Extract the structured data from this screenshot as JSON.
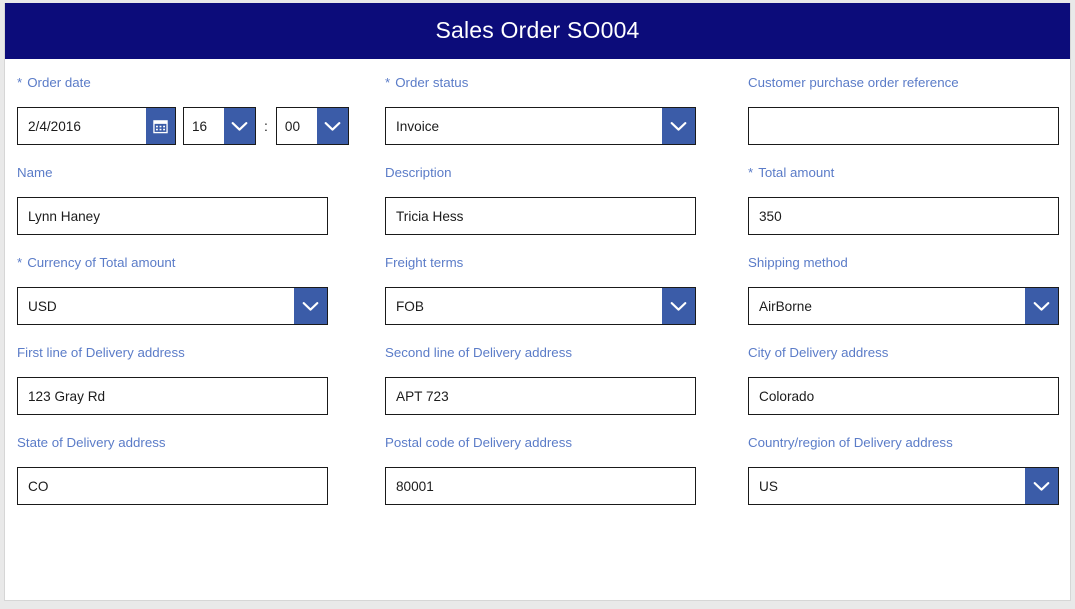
{
  "header": {
    "title": "Sales Order SO004",
    "background": "#0c0c7a",
    "text_color": "#ffffff"
  },
  "theme": {
    "label_color": "#5b7cc8",
    "accent_button": "#3b5ca8",
    "field_border": "#1a1a1a",
    "page_background": "#e9e9e9",
    "card_background": "#ffffff"
  },
  "required_marker": "*",
  "time_separator": ":",
  "fields": {
    "order_date": {
      "label": "Order date",
      "required": true,
      "value": "2/4/2016",
      "calendar_icon": "calendar-icon",
      "hour": "16",
      "minute": "00"
    },
    "order_status": {
      "label": "Order status",
      "required": true,
      "value": "Invoice"
    },
    "customer_po_reference": {
      "label": "Customer purchase order reference",
      "required": false,
      "value": ""
    },
    "name": {
      "label": "Name",
      "required": false,
      "value": "Lynn Haney"
    },
    "description": {
      "label": "Description",
      "required": false,
      "value": "Tricia Hess"
    },
    "total_amount": {
      "label": "Total amount",
      "required": true,
      "value": "350"
    },
    "currency": {
      "label": "Currency of Total amount",
      "required": true,
      "value": "USD"
    },
    "freight_terms": {
      "label": "Freight terms",
      "required": false,
      "value": "FOB"
    },
    "shipping_method": {
      "label": "Shipping method",
      "required": false,
      "value": "AirBorne"
    },
    "address_line1": {
      "label": "First line of Delivery address",
      "required": false,
      "value": "123 Gray Rd"
    },
    "address_line2": {
      "label": "Second line of Delivery address",
      "required": false,
      "value": "APT 723"
    },
    "address_city": {
      "label": "City of Delivery address",
      "required": false,
      "value": "Colorado"
    },
    "address_state": {
      "label": "State of Delivery address",
      "required": false,
      "value": "CO"
    },
    "address_postal": {
      "label": "Postal code of Delivery address",
      "required": false,
      "value": "80001"
    },
    "address_country": {
      "label": "Country/region of Delivery address",
      "required": false,
      "value": "US"
    }
  }
}
